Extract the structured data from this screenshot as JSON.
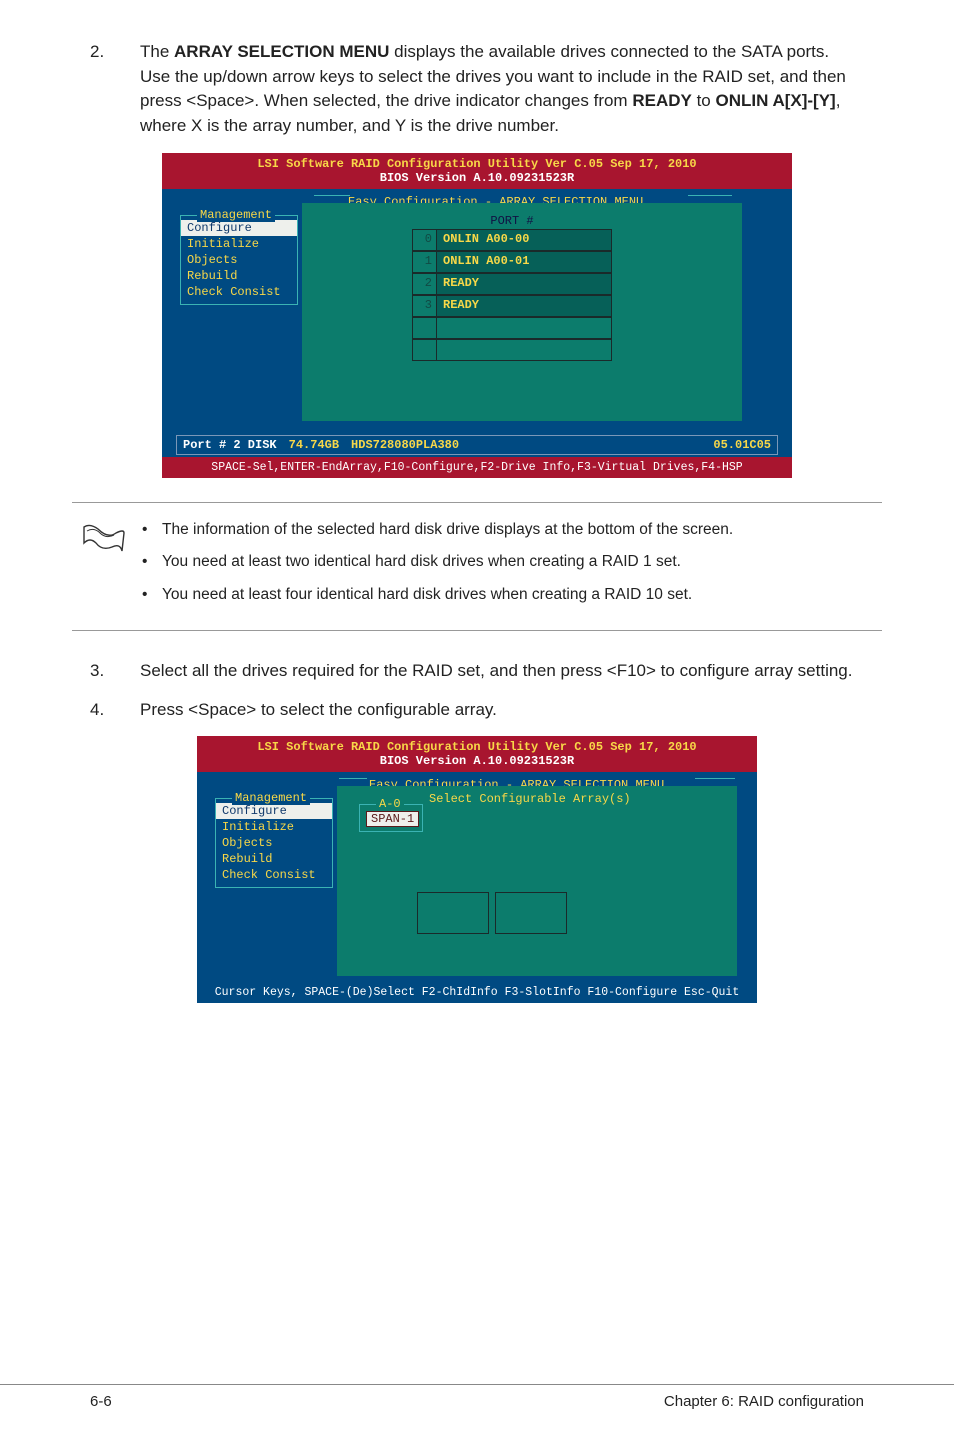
{
  "step2": {
    "num": "2.",
    "text_pre": "The ",
    "b1": "ARRAY SELECTION MENU",
    "text_mid1": " displays the available drives connected to the SATA ports. Use the up/down arrow keys to select the drives you want to include in the RAID set, and then press <Space>. When selected, the drive indicator changes from ",
    "b2": "READY",
    "text_mid2": " to ",
    "b3": "ONLIN A[X]-[Y]",
    "text_mid3": ", where X is the array number, and Y is the drive number."
  },
  "raid1": {
    "title_left": "LSI Software RAID Configuration Utility Ver C.05 Sep 17, 2010",
    "title_sub": "BIOS Version   A.10.09231523R",
    "easytitle": "Easy Configuration - ARRAY SELECTION MENU",
    "mgmt_label": "Management",
    "mgmt_items": [
      "Configure",
      "Initialize",
      "Objects",
      "Rebuild",
      "Check Consist"
    ],
    "port_head": "PORT #",
    "ports": [
      {
        "idx": "0",
        "val": "ONLIN A00-00"
      },
      {
        "idx": "1",
        "val": "ONLIN A00-01"
      },
      {
        "idx": "2",
        "val": "READY"
      },
      {
        "idx": "3",
        "val": "READY"
      },
      {
        "idx": "",
        "val": ""
      },
      {
        "idx": "",
        "val": ""
      }
    ],
    "info_left1": "Port # 2 DISK",
    "info_left2": "74.74GB",
    "info_left3": "HDS728080PLA380",
    "info_right": "05.01C05",
    "bottom": "SPACE-Sel,ENTER-EndArray,F10-Configure,F2-Drive Info,F3-Virtual Drives,F4-HSP"
  },
  "notes": {
    "n1": "The information of the selected hard disk drive displays at the bottom of the screen.",
    "n2": "You need at least two identical hard disk drives when creating a RAID 1 set.",
    "n3": "You need at least four identical hard disk drives when creating a RAID 10 set."
  },
  "step3": {
    "num": "3.",
    "text": "Select all the drives required for the RAID set, and then press <F10> to configure array setting."
  },
  "step4": {
    "num": "4.",
    "text": "Press <Space> to select the configurable array."
  },
  "raid2": {
    "title_left": "LSI Software RAID Configuration Utility Ver C.05 Sep 17, 2010",
    "title_sub": "BIOS Version   A.10.09231523R",
    "easytitle": "Easy Configuration - ARRAY SELECTION MENU",
    "seltitle": "Select Configurable Array(s)",
    "mgmt_label": "Management",
    "mgmt_items": [
      "Configure",
      "Initialize",
      "Objects",
      "Rebuild",
      "Check Consist"
    ],
    "a_label": "A-0",
    "span": "SPAN-1",
    "bottom": "Cursor Keys, SPACE-(De)Select F2-ChIdInfo F3-SlotInfo F10-Configure Esc-Quit"
  },
  "footer": {
    "left": "6-6",
    "right": "Chapter 6: RAID configuration"
  }
}
